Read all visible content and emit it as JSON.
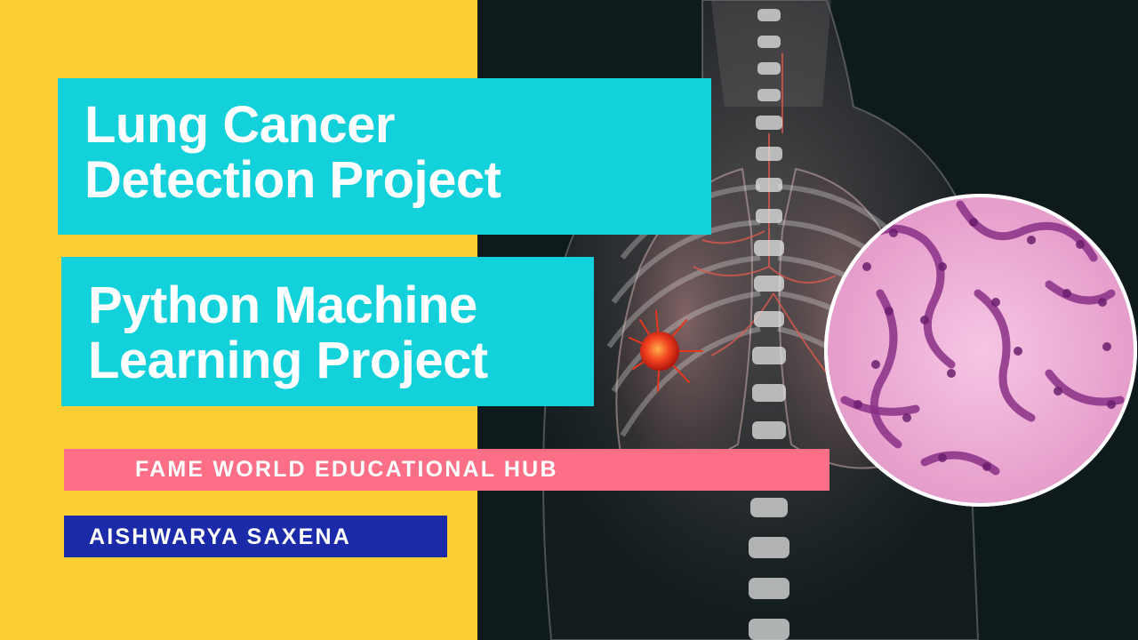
{
  "title": {
    "line1": "Lung Cancer",
    "line2": "Detection Project"
  },
  "subtitle": {
    "line1": "Python Machine",
    "line2": "Learning Project"
  },
  "channel": "FAME WORLD EDUCATIONAL HUB",
  "author": "AISHWARYA SAXENA",
  "colors": {
    "background_yellow": "#fdcf33",
    "background_dark": "#0f1a1c",
    "title_box": "#12d1da",
    "channel_band": "#fd6f86",
    "author_band": "#1a2aa8",
    "tissue_pink": "#e9a3cf",
    "tumor": "#e8361b"
  },
  "icons": [
    "lung-xray-illustration",
    "tumor-icon",
    "tissue-micrograph"
  ]
}
